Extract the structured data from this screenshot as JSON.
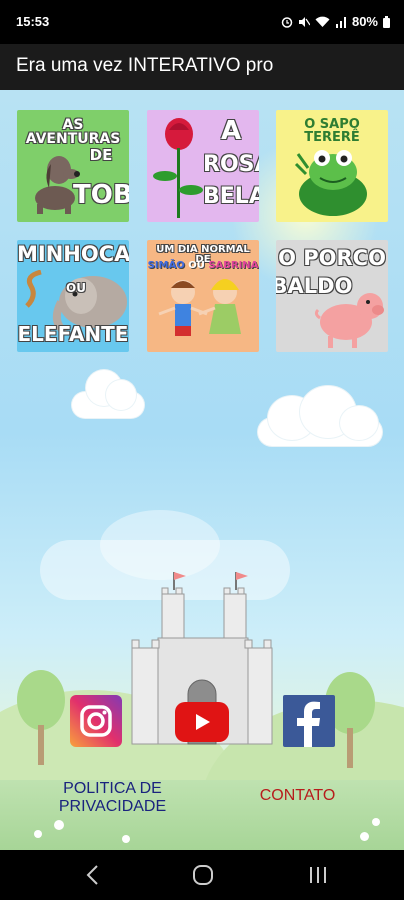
{
  "status_bar": {
    "time": "15:53",
    "battery": "80%"
  },
  "app_bar": {
    "title": "Era uma vez INTERATIVO pro"
  },
  "stories": [
    {
      "line1": "AS AVENTURAS",
      "line2": "DE",
      "line3": "TOBI"
    },
    {
      "line1": "A",
      "line2": "ROSA",
      "line3": "BELA"
    },
    {
      "line1": "O SAPO TERERÊ"
    },
    {
      "line1": "MINHOCA",
      "line2": "OU",
      "line3": "ELEFANTE"
    },
    {
      "line1": "UM DIA NORMAL DE",
      "line2a": "SIMÃO",
      "line2b": "OU",
      "line2c": "SABRINA"
    },
    {
      "line1": "O PORCO",
      "line2": "BALDO"
    }
  ],
  "links": {
    "privacy_line1": "POLITICA DE",
    "privacy_line2": "PRIVACIDADE",
    "contact": "CONTATO"
  },
  "colors": {
    "privacy": "#1a237e",
    "contact": "#b71c1c",
    "appbar": "#1b1b1b",
    "sky": "#a8dcf5"
  },
  "icons": [
    "instagram-icon",
    "youtube-icon",
    "facebook-icon",
    "back-icon",
    "home-icon",
    "recents-icon"
  ]
}
